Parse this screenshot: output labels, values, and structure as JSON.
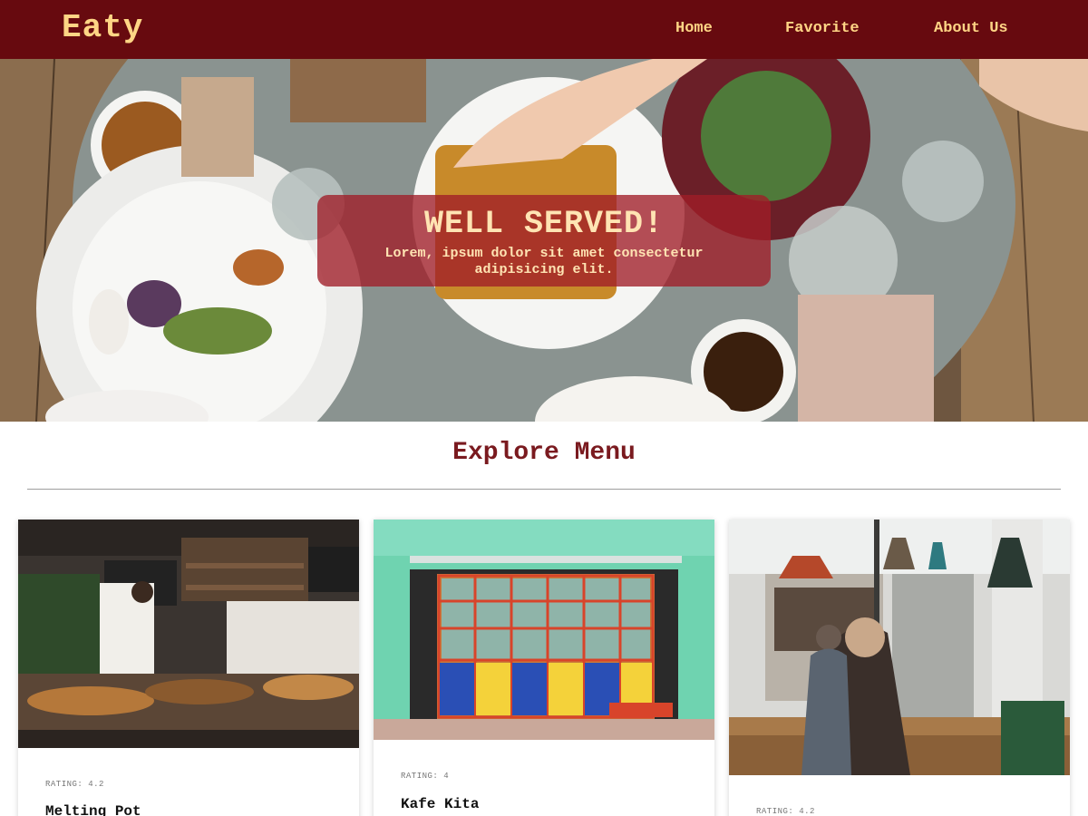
{
  "nav": {
    "brand": "Eaty",
    "links": [
      "Home",
      "Favorite",
      "About Us"
    ]
  },
  "hero": {
    "title": "WELL SERVED!",
    "subtitle": "Lorem, ipsum dolor sit amet consectetur adipisicing elit."
  },
  "menu": {
    "title": "Explore Menu",
    "cards": [
      {
        "rating": "RATING: 4.2",
        "name": "Melting Pot"
      },
      {
        "rating": "RATING: 4",
        "name": "Kafe Kita"
      },
      {
        "rating": "RATING: 4.2",
        "name": ""
      }
    ]
  },
  "colors": {
    "navbar": "#670a0f",
    "nav_text": "#ffd585",
    "accent": "#7a1a1f",
    "hero_box": "#a01e28"
  }
}
